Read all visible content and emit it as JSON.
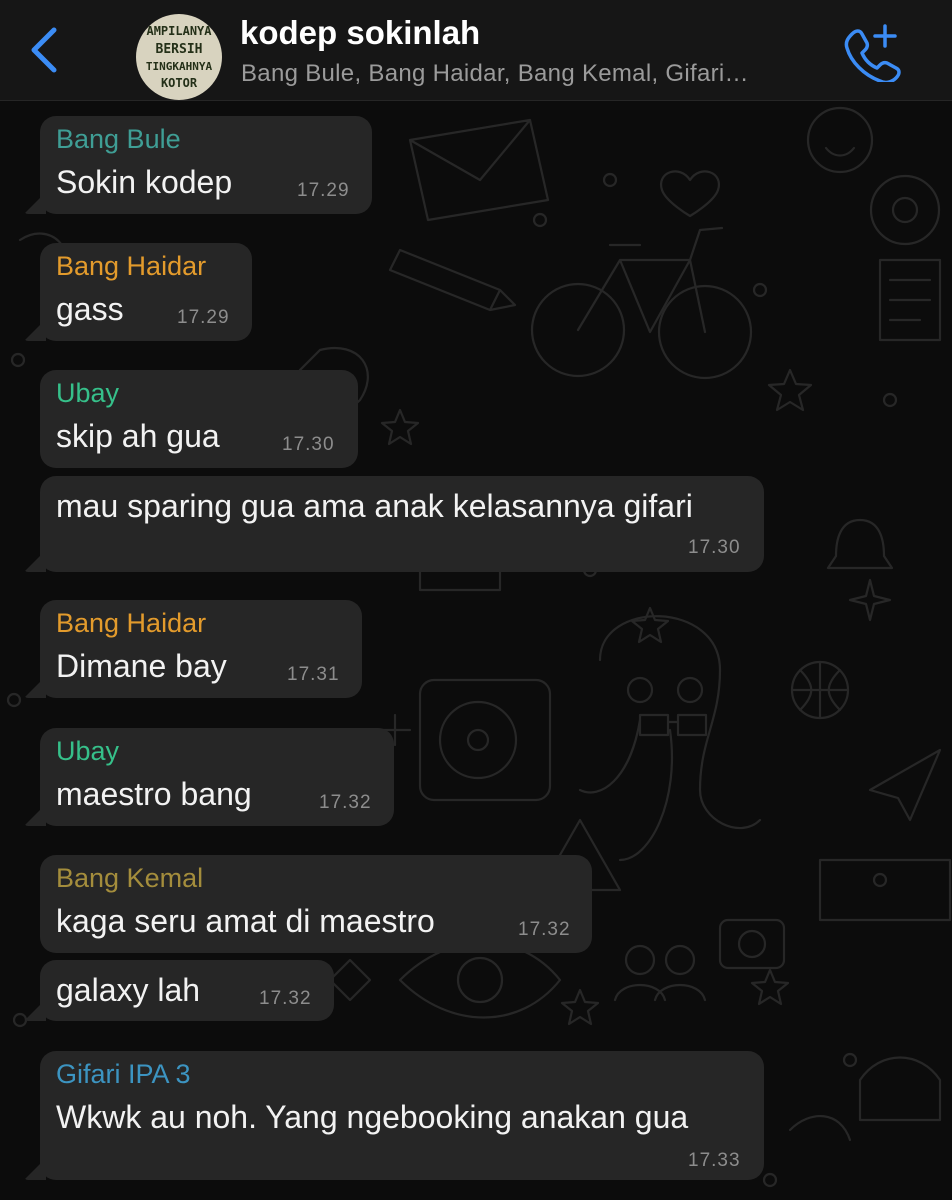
{
  "header": {
    "back_icon": "chevron-left-icon",
    "avatar_lines": [
      "AMPILANYA",
      "BERSIH",
      "TINGKAHNYA",
      "KOTOR"
    ],
    "title": "kodep sokinlah",
    "members": "Bang Bule, Bang Haidar, Bang Kemal, Gifari…",
    "call_icon": "phone-add-icon"
  },
  "colors": {
    "accent_blue": "#3b8cf5",
    "bubble": "#262626",
    "sender_bule": "#3f9e95",
    "sender_haidar": "#e39b2c",
    "sender_ubay": "#36c08a",
    "sender_kemal": "#a48d3c",
    "sender_gifari": "#3c94c1"
  },
  "messages": [
    {
      "sender": "Bang Bule",
      "text": "Sokin kodep",
      "time": "17.29"
    },
    {
      "sender": "Bang Haidar",
      "text": "gass",
      "time": "17.29"
    },
    {
      "sender": "Ubay",
      "text": "skip ah gua",
      "time": "17.30"
    },
    {
      "sender": "",
      "text": "mau sparing gua ama anak kelasannya gifari",
      "time": "17.30"
    },
    {
      "sender": "Bang Haidar",
      "text": "Dimane bay",
      "time": "17.31"
    },
    {
      "sender": "Ubay",
      "text": "maestro bang",
      "time": "17.32"
    },
    {
      "sender": "Bang Kemal",
      "text": "kaga seru amat di maestro",
      "time": "17.32"
    },
    {
      "sender": "",
      "text": "galaxy lah",
      "time": "17.32"
    },
    {
      "sender": "Gifari IPA 3",
      "text": "Wkwk au noh. Yang ngebooking anakan gua",
      "time": "17.33"
    }
  ]
}
